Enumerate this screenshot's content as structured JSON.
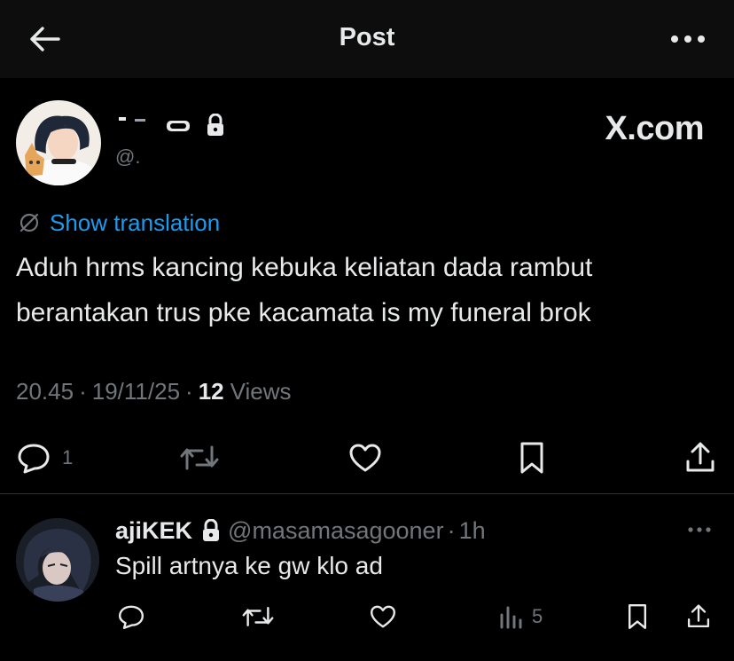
{
  "header": {
    "title": "Post",
    "back_icon": "arrow-left-icon",
    "more_icon": "more-horizontal-icon"
  },
  "post": {
    "author": {
      "handle": "@.",
      "protected_icon": "lock-icon"
    },
    "watermark": "X.com",
    "translate_label": "Show translation",
    "text_lines": [
      "Aduh hrms kancing kebuka keliatan dada rambut",
      "berantakan trus pke kacamata is my funeral brok"
    ],
    "meta": {
      "time": "20.45",
      "date": "19/11/25",
      "views_count": "12",
      "views_label": "Views"
    },
    "actions": {
      "reply_count": "1",
      "icons": [
        "reply-icon",
        "repost-icon",
        "like-icon",
        "bookmark-icon",
        "share-icon"
      ]
    }
  },
  "reply": {
    "name": "ajiKEK",
    "handle": "@masamasagooner",
    "time": "1h",
    "text": "Spill artnya ke gw klo ad",
    "actions": {
      "views_count": "5",
      "icons": [
        "reply-icon",
        "repost-icon",
        "like-icon",
        "analytics-icon",
        "bookmark-icon",
        "share-icon"
      ]
    }
  },
  "colors": {
    "background": "#000000",
    "topbar": "#0d0d0d",
    "text_primary": "#e7e9ea",
    "text_secondary": "#71767b",
    "link": "#1d9bf0",
    "divider": "#2f3336"
  }
}
